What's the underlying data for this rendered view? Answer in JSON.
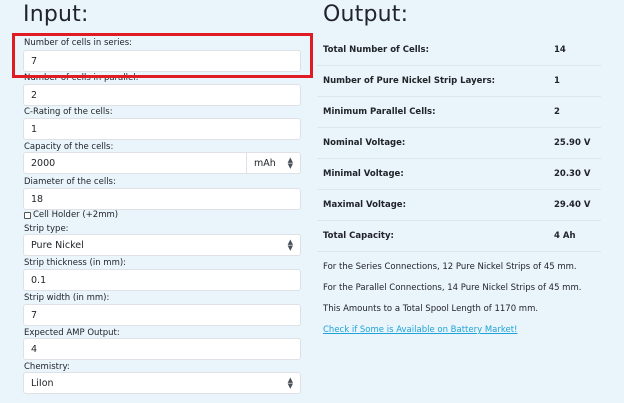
{
  "input": {
    "heading": "Input:",
    "fields": [
      {
        "label": "Number of cells in series:",
        "value": "7"
      },
      {
        "label": "Number of cells in parallel:",
        "value": "2"
      },
      {
        "label": "C-Rating of the cells:",
        "value": "1"
      },
      {
        "label": "Capacity of the cells:",
        "value": "2000",
        "unit": "mAh"
      },
      {
        "label": "Diameter of the cells:",
        "value": "18"
      },
      {
        "label": "Strip type:",
        "value": "Pure Nickel"
      },
      {
        "label": "Strip thickness (in mm):",
        "value": "0.1"
      },
      {
        "label": "Strip width (in mm):",
        "value": "7"
      },
      {
        "label": "Expected AMP Output:",
        "value": "4"
      },
      {
        "label": "Chemistry:",
        "value": "LiIon"
      }
    ],
    "cell_holder_label": "Cell Holder (+2mm)"
  },
  "output": {
    "heading": "Output:",
    "rows": [
      {
        "key": "Total Number of Cells:",
        "value": "14"
      },
      {
        "key": "Number of Pure Nickel Strip Layers:",
        "value": "1"
      },
      {
        "key": "Minimum Parallel Cells:",
        "value": "2"
      },
      {
        "key": "Nominal Voltage:",
        "value": "25.90 V"
      },
      {
        "key": "Minimal Voltage:",
        "value": "20.30 V"
      },
      {
        "key": "Maximal Voltage:",
        "value": "29.40 V"
      },
      {
        "key": "Total Capacity:",
        "value": "4 Ah"
      }
    ],
    "series_text": "For the Series Connections, 12 Pure Nickel Strips of 45 mm.",
    "parallel_text": "For the Parallel Connections, 14 Pure Nickel Strips of 45 mm.",
    "total_text": "This Amounts to a Total Spool Length of 1170 mm.",
    "link_text": "Check if Some is Available on Battery Market!"
  },
  "colors": {
    "background": "#eaf4fb",
    "highlight": "#e01b24",
    "link": "#1fa3d8"
  }
}
